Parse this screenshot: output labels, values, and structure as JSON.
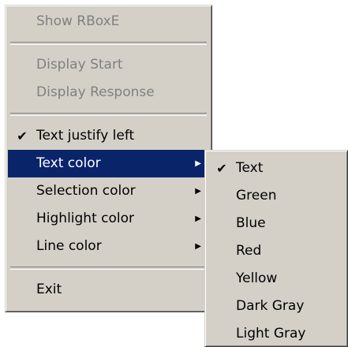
{
  "main_menu": {
    "show_rboxe": "Show RBoxE",
    "display_start": "Display Start",
    "display_response": "Display Response",
    "text_justify_left": "Text justify left",
    "text_color": "Text color",
    "selection_color": "Selection color",
    "highlight_color": "Highlight color",
    "line_color": "Line color",
    "exit": "Exit",
    "check_glyph": "✔",
    "arrow_glyph": "▶"
  },
  "submenu": {
    "text": "Text",
    "green": "Green",
    "blue": "Blue",
    "red": "Red",
    "yellow": "Yellow",
    "dark_gray": "Dark Gray",
    "light_gray": "Light Gray",
    "check_glyph": "✔"
  },
  "colors": {
    "menu_face": "#d4d0c8",
    "highlight": "#0a246a",
    "disabled_text": "#808080"
  }
}
